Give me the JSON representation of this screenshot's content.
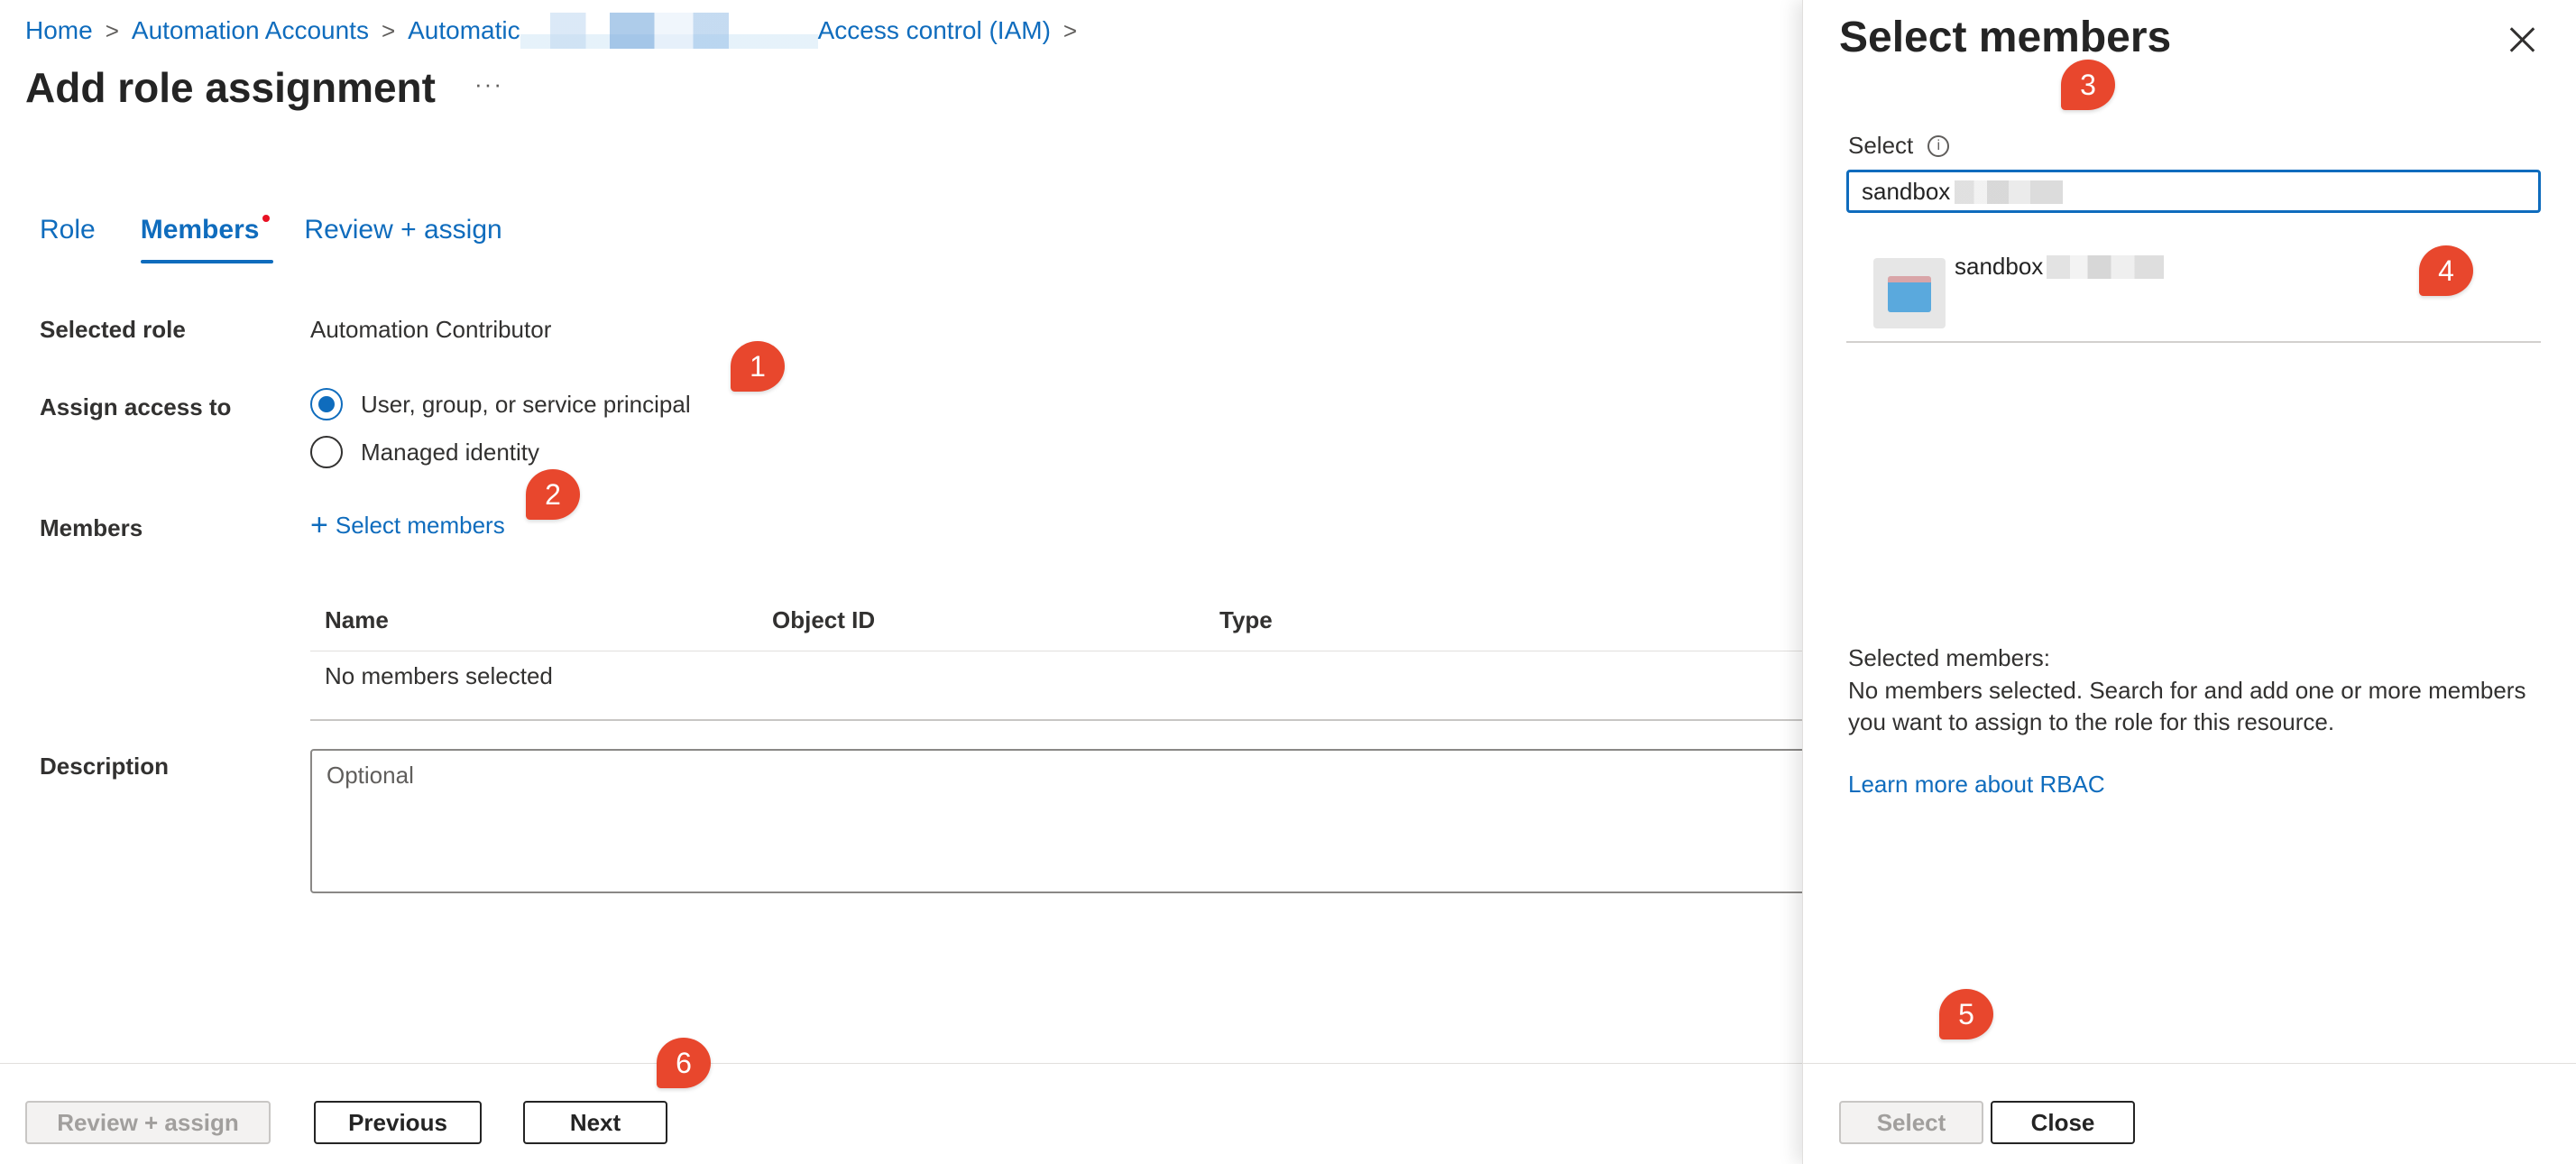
{
  "breadcrumb": {
    "home": "Home",
    "automation_accounts": "Automation Accounts",
    "automation_partial": "Automatic",
    "access_control": "Access control (IAM)",
    "separator": ">"
  },
  "page": {
    "title": "Add role assignment",
    "more_label": "···"
  },
  "tabs": [
    {
      "label": "Role"
    },
    {
      "label": "Members"
    },
    {
      "label": "Review + assign"
    }
  ],
  "form": {
    "selected_role_label": "Selected role",
    "selected_role_value": "Automation Contributor",
    "assign_access_label": "Assign access to",
    "option_user": "User, group, or service principal",
    "option_managed": "Managed identity",
    "members_label": "Members",
    "select_members_link": "Select members",
    "description_label": "Description",
    "description_placeholder": "Optional"
  },
  "members_table": {
    "columns": [
      "Name",
      "Object ID",
      "Type"
    ],
    "empty_text": "No members selected"
  },
  "footer": {
    "review_assign": "Review + assign",
    "previous": "Previous",
    "next": "Next"
  },
  "panel": {
    "title": "Select members",
    "select_label": "Select",
    "search_value": "sandbox",
    "result_name": "sandbox",
    "selected_members_heading": "Selected members:",
    "selected_members_text": "No members selected. Search for and add one or more members you want to assign to the role for this resource.",
    "learn_more": "Learn more about RBAC",
    "select_button": "Select",
    "close_button": "Close"
  },
  "callouts": [
    "1",
    "2",
    "3",
    "4",
    "5",
    "6"
  ],
  "colors": {
    "accent": "#0f6cbd",
    "callout": "#e8472d",
    "required_dot": "#e81123"
  }
}
